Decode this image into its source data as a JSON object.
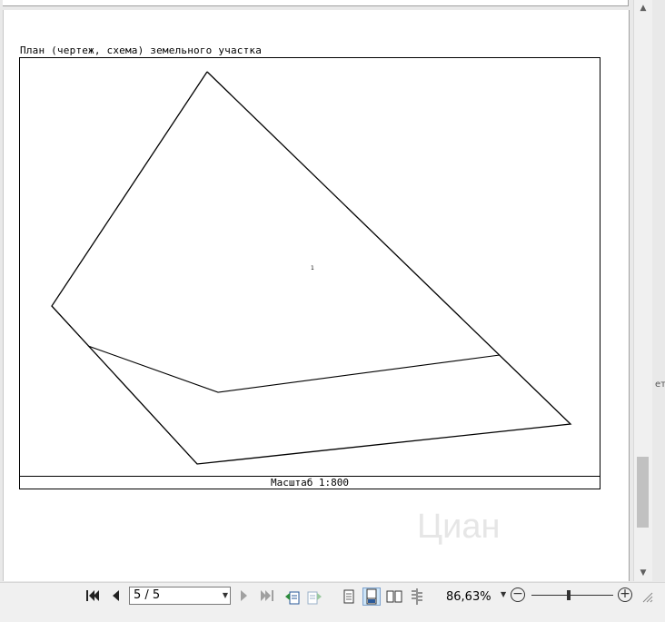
{
  "document": {
    "plan_title": "План (чертеж, схема) земельного участка",
    "scale_label": "Масштаб 1:800",
    "parcel_label": "1",
    "watermark": "Циан"
  },
  "side_text": "ет",
  "scrollbar": {
    "up_icon": "▲",
    "down_icon": "▼"
  },
  "toolbar": {
    "first_page_icon": "first-page-icon",
    "prev_page_icon": "prev-page-icon",
    "page_indicator": "5 / 5",
    "next_page_icon": "next-page-icon",
    "last_page_icon": "last-page-icon",
    "zoom_value": "86,63%",
    "zoom_level": 0.45,
    "zoom_minus": "−",
    "zoom_plus": "+"
  },
  "colors": {
    "toolbar_bg": "#f0f0f0",
    "active_view": "#cce4f7",
    "scroll_thumb": "#c1c1c1"
  }
}
